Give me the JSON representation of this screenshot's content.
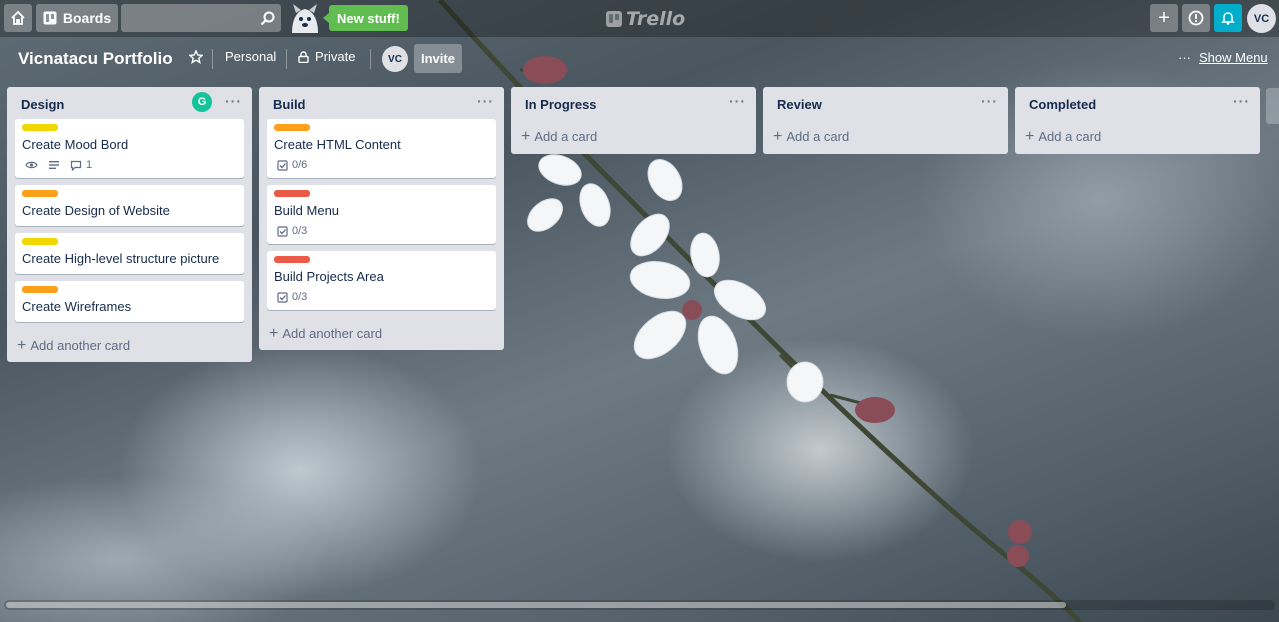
{
  "topbar": {
    "boards_label": "Boards",
    "search_placeholder": "",
    "new_stuff_label": "New stuff!",
    "logo_text": "Trello",
    "avatar_initials": "VC"
  },
  "board": {
    "title": "Vicnatacu Portfolio",
    "team_label": "Personal",
    "visibility_label": "Private",
    "member_initials": "VC",
    "invite_label": "Invite",
    "show_menu_label": "Show Menu",
    "menu_dots": "···"
  },
  "lists": [
    {
      "title": "Design",
      "menu": "···",
      "cards": [
        {
          "title": "Create Mood Bord",
          "label_color": "yellow",
          "badges": {
            "watch": true,
            "description": true,
            "comments": "1"
          }
        },
        {
          "title": "Create Design of Website",
          "label_color": "orange"
        },
        {
          "title": "Create High-level structure picture",
          "label_color": "yellow"
        },
        {
          "title": "Create Wireframes",
          "label_color": "orange"
        }
      ],
      "add_label": "Add another card"
    },
    {
      "title": "Build",
      "menu": "···",
      "cards": [
        {
          "title": "Create HTML Content",
          "label_color": "orange",
          "checklist": "0/6"
        },
        {
          "title": "Build Menu",
          "label_color": "red",
          "checklist": "0/3"
        },
        {
          "title": "Build Projects Area",
          "label_color": "red",
          "checklist": "0/3"
        }
      ],
      "add_label": "Add another card"
    },
    {
      "title": "In Progress",
      "menu": "···",
      "cards": [],
      "add_label": "Add a card"
    },
    {
      "title": "Review",
      "menu": "···",
      "cards": [],
      "add_label": "Add a card"
    },
    {
      "title": "Completed",
      "menu": "···",
      "cards": [],
      "add_label": "Add a card"
    }
  ],
  "colors": {
    "yellow": "#f2d600",
    "orange": "#ff9f1a",
    "red": "#eb5a46",
    "new_stuff": "#61bd4f",
    "notification": "#00aecc"
  },
  "icons": [
    "home-icon",
    "boards-icon",
    "search-icon",
    "plus-icon",
    "info-icon",
    "bell-icon",
    "star-icon",
    "lock-icon",
    "eye-icon",
    "description-icon",
    "comment-icon",
    "checklist-icon"
  ]
}
